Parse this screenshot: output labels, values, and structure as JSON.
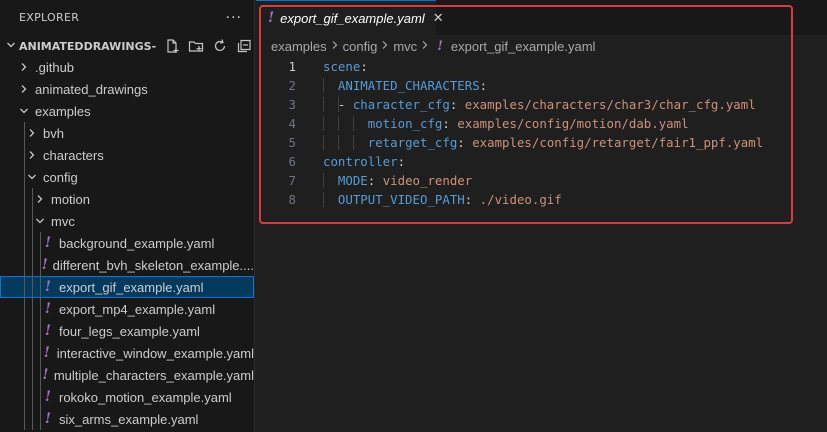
{
  "sidebar": {
    "title": "EXPLORER",
    "more": "···",
    "workspace": "ANIMATEDDRAWINGS-...",
    "tree": [
      {
        "label": ".github",
        "type": "folder",
        "open": false,
        "depth": 0
      },
      {
        "label": "animated_drawings",
        "type": "folder",
        "open": false,
        "depth": 0
      },
      {
        "label": "examples",
        "type": "folder",
        "open": true,
        "depth": 0
      },
      {
        "label": "bvh",
        "type": "folder",
        "open": false,
        "depth": 1
      },
      {
        "label": "characters",
        "type": "folder",
        "open": false,
        "depth": 1
      },
      {
        "label": "config",
        "type": "folder",
        "open": true,
        "depth": 1
      },
      {
        "label": "motion",
        "type": "folder",
        "open": false,
        "depth": 2
      },
      {
        "label": "mvc",
        "type": "folder",
        "open": true,
        "depth": 2
      },
      {
        "label": "background_example.yaml",
        "type": "file",
        "depth": 3
      },
      {
        "label": "different_bvh_skeleton_example....",
        "type": "file",
        "depth": 3
      },
      {
        "label": "export_gif_example.yaml",
        "type": "file",
        "depth": 3,
        "selected": true
      },
      {
        "label": "export_mp4_example.yaml",
        "type": "file",
        "depth": 3
      },
      {
        "label": "four_legs_example.yaml",
        "type": "file",
        "depth": 3
      },
      {
        "label": "interactive_window_example.yaml",
        "type": "file",
        "depth": 3
      },
      {
        "label": "multiple_characters_example.yaml",
        "type": "file",
        "depth": 3
      },
      {
        "label": "rokoko_motion_example.yaml",
        "type": "file",
        "depth": 3
      },
      {
        "label": "six_arms_example.yaml",
        "type": "file",
        "depth": 3
      }
    ]
  },
  "editor": {
    "tab_label": "export_gif_example.yaml",
    "tab_close": "✕",
    "file_icon": "!",
    "breadcrumbs": [
      "examples",
      "config",
      "mvc",
      "export_gif_example.yaml"
    ],
    "lines": [
      {
        "n": "1",
        "indent": 0,
        "key": "scene",
        "colon": ":",
        "value": ""
      },
      {
        "n": "2",
        "indent": 1,
        "key": "ANIMATED_CHARACTERS",
        "colon": ":",
        "value": ""
      },
      {
        "n": "3",
        "indent": 2,
        "dash": "- ",
        "key": "character_cfg",
        "colon": ": ",
        "value": "examples/characters/char3/char_cfg.yaml"
      },
      {
        "n": "4",
        "indent": 3,
        "key": "motion_cfg",
        "colon": ": ",
        "value": "examples/config/motion/dab.yaml"
      },
      {
        "n": "5",
        "indent": 3,
        "key": "retarget_cfg",
        "colon": ": ",
        "value": "examples/config/retarget/fair1_ppf.yaml"
      },
      {
        "n": "6",
        "indent": 0,
        "key": "controller",
        "colon": ":",
        "value": ""
      },
      {
        "n": "7",
        "indent": 1,
        "key": "MODE",
        "colon": ": ",
        "value": "video_render"
      },
      {
        "n": "8",
        "indent": 1,
        "key": "OUTPUT_VIDEO_PATH",
        "colon": ": ",
        "value": "./video.gif"
      }
    ]
  },
  "colors": {
    "highlight": "#e0393b",
    "yaml_icon": "#a074c4",
    "key": "#569cd6",
    "string": "#ce9178",
    "selection": "#04395e"
  }
}
